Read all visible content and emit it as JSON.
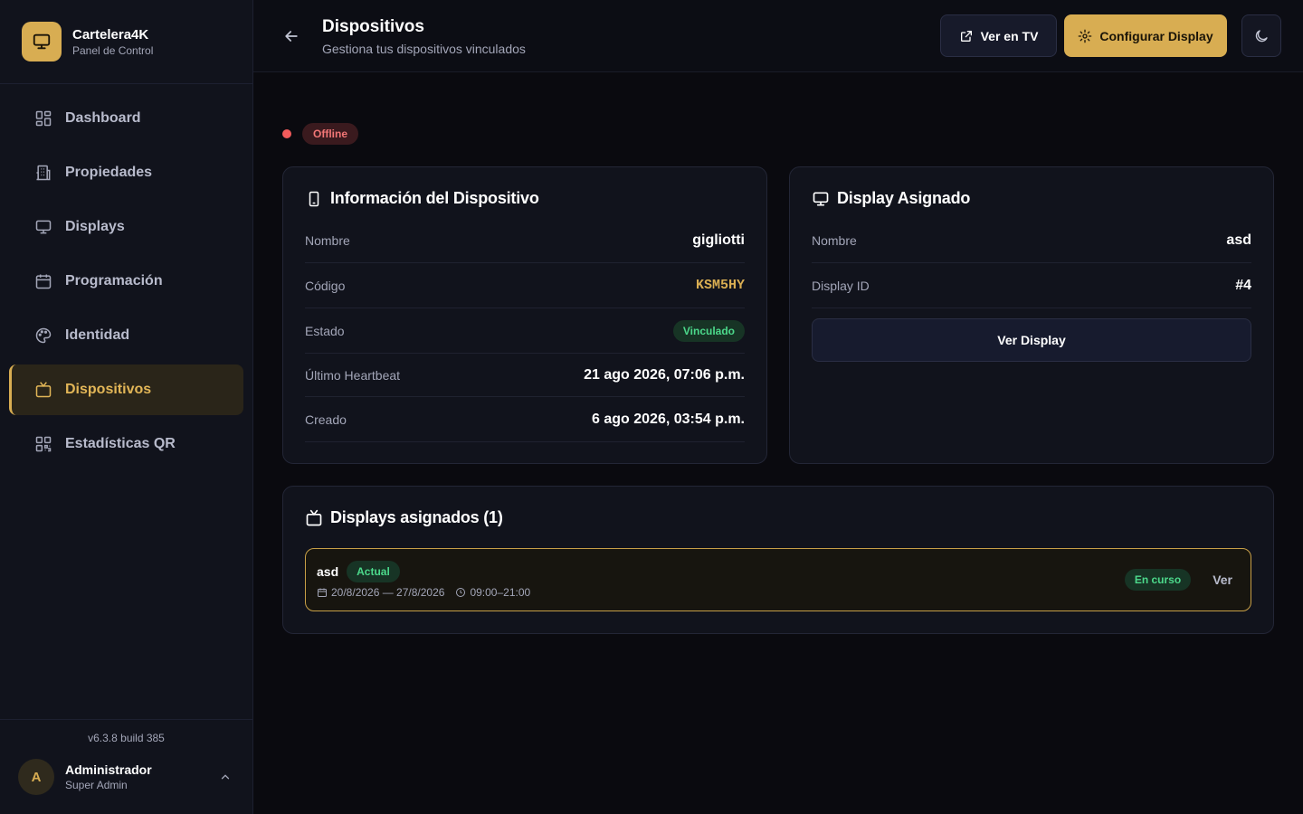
{
  "brand": {
    "title": "Cartelera4K",
    "subtitle": "Panel de Control"
  },
  "sidebar": {
    "items": [
      {
        "label": "Dashboard",
        "icon": "dashboard-grid-icon"
      },
      {
        "label": "Propiedades",
        "icon": "building-icon"
      },
      {
        "label": "Displays",
        "icon": "monitor-icon"
      },
      {
        "label": "Programación",
        "icon": "calendar-icon"
      },
      {
        "label": "Identidad",
        "icon": "palette-icon"
      },
      {
        "label": "Dispositivos",
        "icon": "tv-icon",
        "active": true
      },
      {
        "label": "Estadísticas QR",
        "icon": "qr-code-icon"
      }
    ],
    "version": "v6.3.8 build 385",
    "user": {
      "initial": "A",
      "name": "Administrador",
      "role": "Super Admin"
    }
  },
  "header": {
    "title": "Dispositivos",
    "subtitle": "Gestiona tus dispositivos vinculados",
    "ver_tv_label": "Ver en TV",
    "config_label": "Configurar Display"
  },
  "status": {
    "label": "Offline",
    "color": "#f25b5b"
  },
  "device_card": {
    "title": "Información del Dispositivo",
    "rows": [
      {
        "label": "Nombre",
        "value": "gigliotti"
      },
      {
        "label": "Código",
        "value": "KSM5HY"
      },
      {
        "label": "Estado",
        "value": "Vinculado"
      },
      {
        "label": "Último Heartbeat",
        "value": "21 ago 2026, 07:06 p.m."
      },
      {
        "label": "Creado",
        "value": "6 ago 2026, 03:54 p.m."
      }
    ]
  },
  "display_card": {
    "title": "Display Asignado",
    "rows": [
      {
        "label": "Nombre",
        "value": "asd"
      },
      {
        "label": "Display ID",
        "value": "#4"
      }
    ],
    "button_label": "Ver Display"
  },
  "assigned": {
    "title": "Displays asignados (1)",
    "items": [
      {
        "name": "asd",
        "badge": "Actual",
        "dates": "20/8/2026 — 27/8/2026",
        "hours": "09:00–21:00",
        "status": "En curso",
        "action": "Ver"
      }
    ]
  },
  "colors": {
    "accent": "#d8ad52",
    "success": "#4cd98b",
    "danger": "#f25b5b",
    "background": "#0a0a0f"
  }
}
